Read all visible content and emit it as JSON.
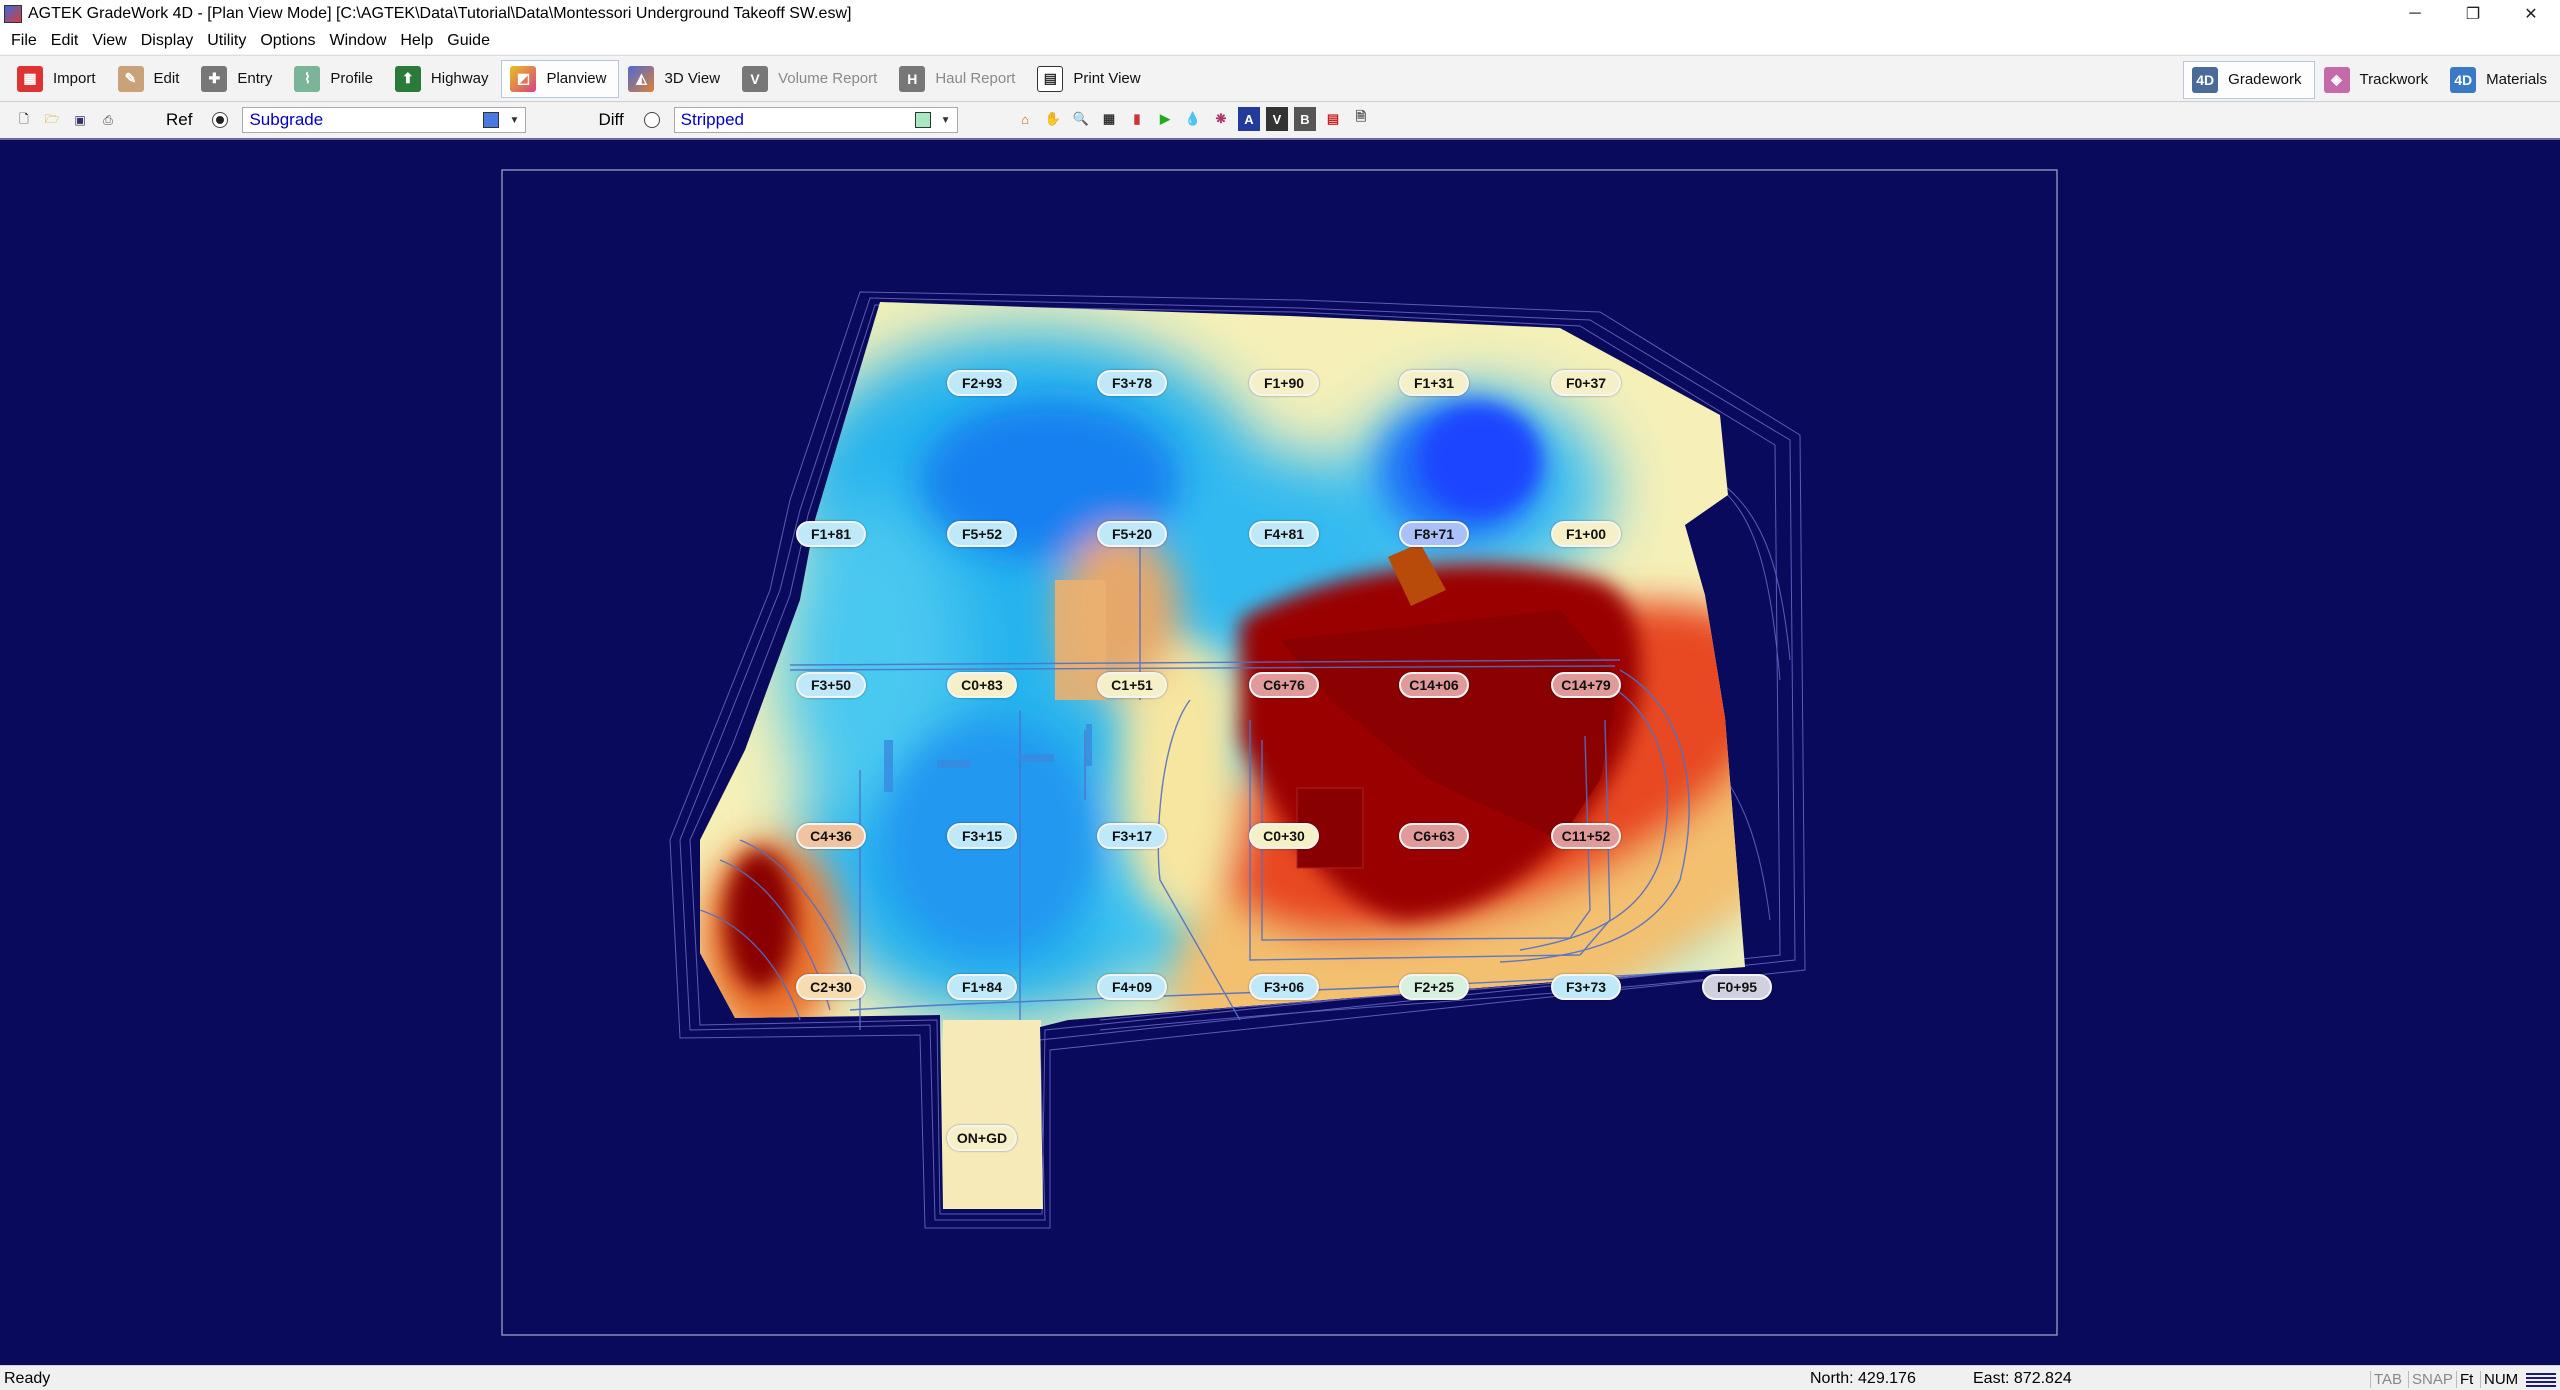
{
  "window": {
    "title": "AGTEK GradeWork 4D - [Plan View Mode]  [C:\\AGTEK\\Data\\Tutorial\\Data\\Montessori Underground Takeoff SW.esw]",
    "minimize": "─",
    "restore": "❐",
    "close": "✕"
  },
  "menu": [
    "File",
    "Edit",
    "View",
    "Display",
    "Utility",
    "Options",
    "Window",
    "Help",
    "Guide"
  ],
  "toolbar": {
    "buttons": [
      {
        "label": "Import",
        "icon": "import-icon",
        "color": "#d33"
      },
      {
        "label": "Edit",
        "icon": "edit-icon",
        "color": "#b98"
      },
      {
        "label": "Entry",
        "icon": "entry-icon",
        "color": "#557"
      },
      {
        "label": "Profile",
        "icon": "profile-icon",
        "color": "#6a8"
      },
      {
        "label": "Highway",
        "icon": "highway-icon",
        "color": "#2a5"
      },
      {
        "label": "Planview",
        "icon": "planview-icon",
        "color": "#e8b020"
      },
      {
        "label": "3D View",
        "icon": "3d-view-icon",
        "color": "#d84"
      },
      {
        "label": "Volume Report",
        "icon": "volume-report-icon",
        "color": "#666"
      },
      {
        "label": "Haul Report",
        "icon": "haul-report-icon",
        "color": "#666"
      },
      {
        "label": "Print View",
        "icon": "print-view-icon",
        "color": "#445"
      }
    ],
    "right": [
      {
        "label": "Gradework",
        "icon": "gradework-icon",
        "color": "#4a6a9a"
      },
      {
        "label": "Trackwork",
        "icon": "trackwork-icon",
        "color": "#c46aa8"
      },
      {
        "label": "Materials",
        "icon": "materials-icon",
        "color": "#3a7ac4"
      }
    ]
  },
  "toolbar2": {
    "ref_label": "Ref",
    "ref_surface": "Subgrade",
    "ref_color": "#4a7ae0",
    "diff_label": "Diff",
    "diff_surface": "Stripped",
    "diff_color": "#a8e8c0"
  },
  "stations": [
    {
      "label": "F2+93",
      "tone": "cool"
    },
    {
      "label": "F3+78",
      "tone": "cool"
    },
    {
      "label": "F1+90",
      "tone": "light"
    },
    {
      "label": "F1+31",
      "tone": "light"
    },
    {
      "label": "F0+37",
      "tone": "light"
    },
    {
      "label": "F1+81",
      "tone": "cool"
    },
    {
      "label": "F5+52",
      "tone": "cool"
    },
    {
      "label": "F5+20",
      "tone": "cool"
    },
    {
      "label": "F4+81",
      "tone": "cool"
    },
    {
      "label": "F8+71",
      "tone": "blue"
    },
    {
      "label": "F1+00",
      "tone": "light"
    },
    {
      "label": "F3+50",
      "tone": "cool"
    },
    {
      "label": "C0+83",
      "tone": "light"
    },
    {
      "label": "C1+51",
      "tone": "light"
    },
    {
      "label": "C6+76",
      "tone": "hot"
    },
    {
      "label": "C14+06",
      "tone": "hot"
    },
    {
      "label": "C14+79",
      "tone": "hot"
    },
    {
      "label": "C4+36",
      "tone": "warm"
    },
    {
      "label": "F3+15",
      "tone": "cool"
    },
    {
      "label": "F3+17",
      "tone": "cool"
    },
    {
      "label": "C0+30",
      "tone": "light"
    },
    {
      "label": "C6+63",
      "tone": "hot"
    },
    {
      "label": "C11+52",
      "tone": "hot"
    },
    {
      "label": "C2+30",
      "tone": "warm"
    },
    {
      "label": "F1+84",
      "tone": "cool"
    },
    {
      "label": "F4+09",
      "tone": "cool"
    },
    {
      "label": "F3+06",
      "tone": "cool"
    },
    {
      "label": "F2+25",
      "tone": "light"
    },
    {
      "label": "F3+73",
      "tone": "cool"
    },
    {
      "label": "F0+95",
      "tone": "light"
    },
    {
      "label": "ON+GD",
      "tone": "light"
    }
  ],
  "status": {
    "ready": "Ready",
    "north": "North: 429.176",
    "east": "East: 872.824",
    "indicators": [
      "TAB",
      "SNAP",
      "Ft",
      "NUM"
    ]
  },
  "colors": {
    "canvas_bg": "#0a0a5c",
    "cut_deep": "#8b0000",
    "fill_deep": "#2255ff"
  }
}
